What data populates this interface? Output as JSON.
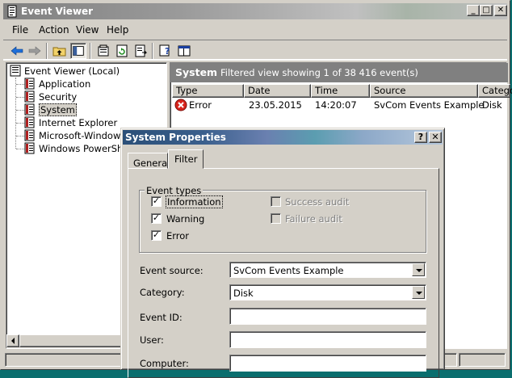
{
  "main_window": {
    "title": "Event Viewer",
    "caption": {
      "minimize": "_",
      "maximize": "□",
      "close": "✕"
    }
  },
  "menu": [
    "File",
    "Action",
    "View",
    "Help"
  ],
  "toolbar_icons": [
    "back-arrow-icon",
    "forward-arrow-icon",
    "up-folder-icon",
    "show-hide-tree-icon",
    "properties-icon",
    "refresh-icon",
    "export-list-icon",
    "help-icon",
    "console-icon"
  ],
  "tree": {
    "root": "Event Viewer (Local)",
    "items": [
      "Application",
      "Security",
      "System",
      "Internet Explorer",
      "Microsoft-Windows-F",
      "Windows PowerShell"
    ],
    "selected": "System"
  },
  "right_pane": {
    "title": "System",
    "subtitle": "Filtered view showing 1 of 38 416 event(s)",
    "columns": [
      "Type",
      "Date",
      "Time",
      "Source",
      "Catego"
    ],
    "rows": [
      {
        "type": "Error",
        "date": "23.05.2015",
        "time": "14:20:07",
        "source": "SvCom Events Example",
        "category": "Disk"
      }
    ]
  },
  "dialog": {
    "title": "System Properties",
    "caption": {
      "help": "?",
      "close": "✕"
    },
    "tabs": [
      "General",
      "Filter"
    ],
    "active_tab": "Filter",
    "event_types": {
      "legend": "Event types",
      "information": {
        "label": "Information",
        "checked": true
      },
      "warning": {
        "label": "Warning",
        "checked": true
      },
      "error": {
        "label": "Error",
        "checked": true
      },
      "success_audit": {
        "label": "Success audit",
        "checked": false
      },
      "failure_audit": {
        "label": "Failure audit",
        "checked": false
      }
    },
    "fields": {
      "event_source": {
        "label": "Event source:",
        "value": "SvCom Events Example"
      },
      "category": {
        "label": "Category:",
        "value": "Disk"
      },
      "event_id": {
        "label": "Event ID:",
        "value": ""
      },
      "user": {
        "label": "User:",
        "value": ""
      },
      "computer": {
        "label": "Computer:",
        "value": ""
      }
    }
  }
}
